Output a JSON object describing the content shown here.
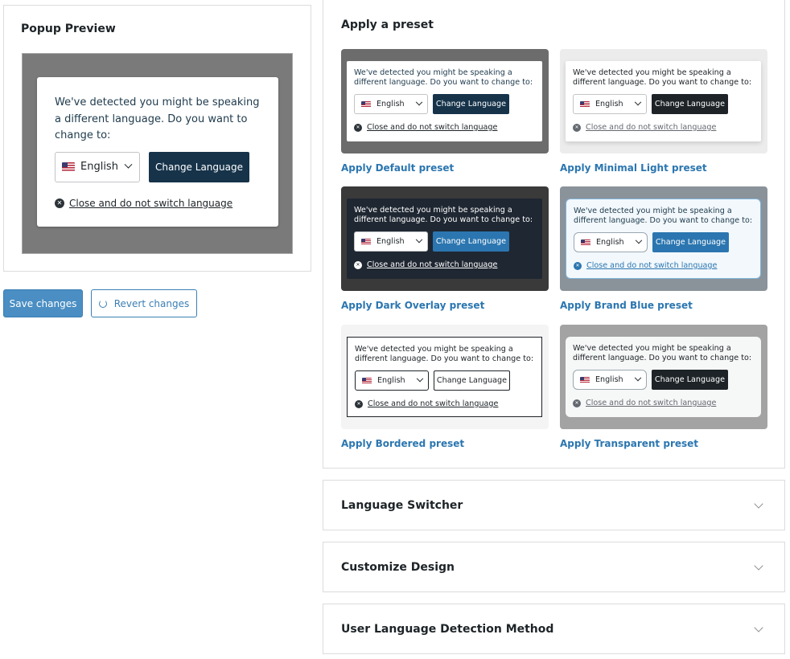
{
  "preview": {
    "title": "Popup Preview",
    "message": "We've detected you might be speaking a different language. Do you want to change to:",
    "language": "English",
    "change_button": "Change Language",
    "close_text": "Close and do not switch language"
  },
  "actions": {
    "save_label": "Save changes",
    "revert_label": "Revert changes"
  },
  "presets": {
    "title": "Apply a preset",
    "message": "We've detected you might be speaking a different language. Do you want to change to:",
    "language": "English",
    "change_button": "Change Language",
    "close_text": "Close and do not switch language",
    "items": [
      {
        "link": "Apply Default preset",
        "backdrop": "#6c6c6c",
        "card_bg": "#ffffff",
        "text_color": "#1e3a4c",
        "button_bg": "#16334a"
      },
      {
        "link": "Apply Minimal Light preset",
        "backdrop": "#ececec",
        "card_bg": "#ffffff",
        "text_color": "#1d2327",
        "button_bg": "#1d2327"
      },
      {
        "link": "Apply Dark Overlay preset",
        "backdrop": "#3a3a3a",
        "card_bg": "#1f2732",
        "text_color": "#ffffff",
        "button_bg": "#2b76b0"
      },
      {
        "link": "Apply Brand Blue preset",
        "backdrop": "#8a929a",
        "card_bg": "#f2f8fc",
        "text_color": "#1e3a4c",
        "button_bg": "#2b76b0"
      },
      {
        "link": "Apply Bordered preset",
        "backdrop": "#f4f4f4",
        "card_bg": "#ffffff",
        "text_color": "#1d2327",
        "button_bg": "#ffffff"
      },
      {
        "link": "Apply Transparent preset",
        "backdrop": "#a3a3a3",
        "card_bg": "#f6f7f7",
        "text_color": "#1d2327",
        "button_bg": "#1d2327"
      }
    ]
  },
  "sections": {
    "language_switcher": "Language Switcher",
    "customize_design": "Customize Design",
    "detection_method": "User Language Detection Method"
  }
}
